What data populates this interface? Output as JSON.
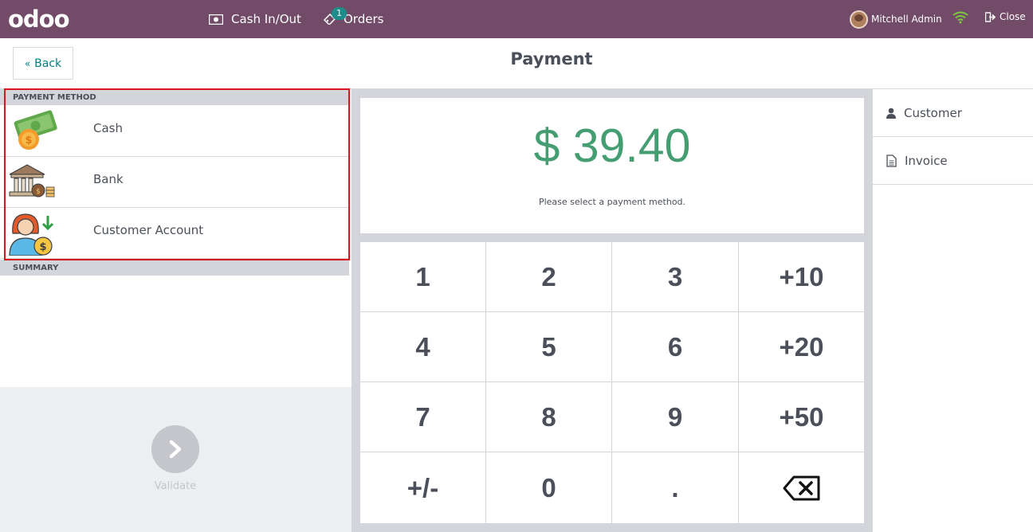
{
  "app": {
    "logo_text": "odoo"
  },
  "topbar": {
    "cash_in_out_label": "Cash In/Out",
    "orders_label": "Orders",
    "orders_badge": "1",
    "user_name": "Mitchell Admin",
    "close_label": "Close",
    "bar_color": "#714b67"
  },
  "header": {
    "back_label": "Back",
    "title": "Payment"
  },
  "payment_methods": {
    "section_title": "PAYMENT METHOD",
    "items": [
      {
        "label": "Cash",
        "icon": "cash-icon"
      },
      {
        "label": "Bank",
        "icon": "bank-icon"
      },
      {
        "label": "Customer Account",
        "icon": "customer-account-icon"
      }
    ]
  },
  "summary": {
    "section_title": "SUMMARY"
  },
  "validate": {
    "label": "Validate"
  },
  "amount": {
    "value": "$ 39.40",
    "hint": "Please select a payment method.",
    "color": "#459e72"
  },
  "numpad": {
    "keys": [
      "1",
      "2",
      "3",
      "+10",
      "4",
      "5",
      "6",
      "+20",
      "7",
      "8",
      "9",
      "+50",
      "+/-",
      "0",
      ".",
      "backspace-icon"
    ]
  },
  "side": {
    "customer_label": "Customer",
    "invoice_label": "Invoice"
  }
}
